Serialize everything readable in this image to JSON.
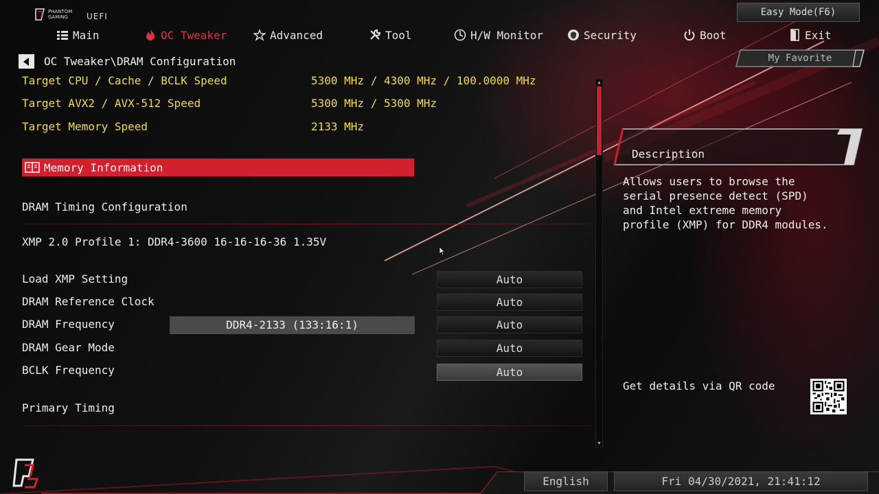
{
  "header": {
    "brand_line1": "PHANTOM",
    "brand_line2": "GAMING",
    "brand_uefi": "UEFI",
    "easy_mode_label": "Easy Mode(F6)"
  },
  "nav": {
    "items": [
      {
        "label": "Main",
        "icon": "list-icon"
      },
      {
        "label": "OC Tweaker",
        "icon": "flame-icon",
        "active": true
      },
      {
        "label": "Advanced",
        "icon": "star-icon"
      },
      {
        "label": "Tool",
        "icon": "wrench-icon"
      },
      {
        "label": "H/W Monitor",
        "icon": "monitor-icon"
      },
      {
        "label": "Security",
        "icon": "shield-icon"
      },
      {
        "label": "Boot",
        "icon": "power-icon"
      },
      {
        "label": "Exit",
        "icon": "door-icon"
      }
    ]
  },
  "breadcrumb": {
    "path": "OC Tweaker\\DRAM Configuration"
  },
  "favorite": {
    "label": "My Favorite"
  },
  "targets": [
    {
      "label": "Target CPU / Cache / BCLK Speed",
      "value": "5300 MHz / 4300 MHz / 100.0000 MHz"
    },
    {
      "label": "Target AVX2 / AVX-512 Speed",
      "value": "5300 MHz / 5300 MHz"
    },
    {
      "label": "Target Memory Speed",
      "value": "2133 MHz"
    }
  ],
  "memory_info": {
    "label": "Memory Information"
  },
  "sections": {
    "dram_timing": "DRAM Timing Configuration",
    "xmp_profile": "XMP 2.0 Profile 1: DDR4-3600 16-16-16-36 1.35V",
    "primary_timing": "Primary Timing"
  },
  "settings": [
    {
      "label": "Load XMP Setting",
      "value": "Auto"
    },
    {
      "label": "DRAM Reference Clock",
      "value": "Auto"
    },
    {
      "label": "DRAM Frequency",
      "value": "Auto",
      "info": "DDR4-2133 (133:16:1)"
    },
    {
      "label": "DRAM Gear Mode",
      "value": "Auto"
    },
    {
      "label": "BCLK Frequency",
      "value": "Auto",
      "selected": true
    }
  ],
  "description": {
    "title": "Description",
    "body": "Allows users to browse the serial presence detect (SPD) and Intel extreme memory profile (XMP) for DDR4 modules.",
    "qr_label": "Get details via QR code"
  },
  "footer": {
    "language": "English",
    "datetime": "Fri 04/30/2021, 21:41:12"
  },
  "colors": {
    "accent": "#d4202c",
    "highlight_text": "#f2dd3a"
  }
}
